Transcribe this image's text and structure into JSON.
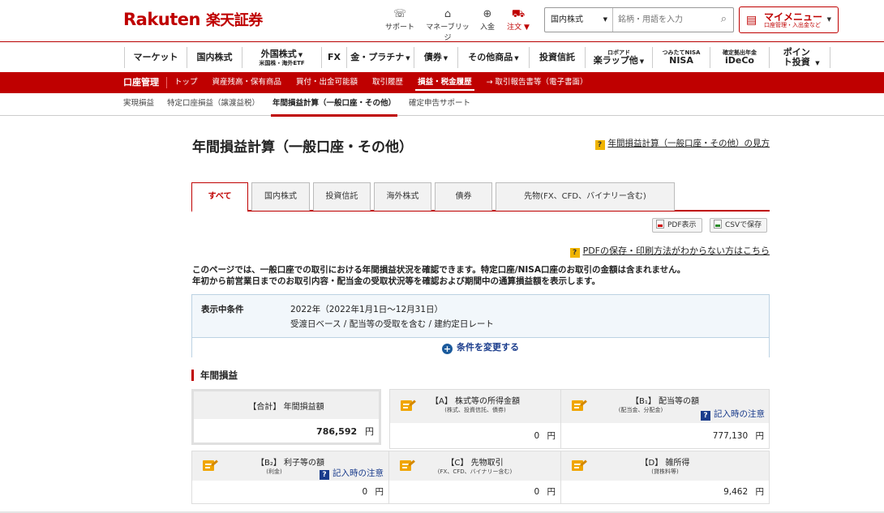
{
  "header": {
    "logo_en": "Rakuten",
    "logo_jp": "楽天証券",
    "utilities": [
      {
        "label": "サポート",
        "icon": "support-icon"
      },
      {
        "label": "マネーブリッジ",
        "icon": "bank-icon"
      },
      {
        "label": "入金",
        "icon": "deposit-icon"
      },
      {
        "label": "注文 ▼",
        "icon": "cart-icon"
      }
    ],
    "search": {
      "category": "国内株式",
      "placeholder": "銘柄・用語を入力"
    },
    "mymenu": {
      "title": "マイメニュー",
      "subtitle": "口座管理・入出金など"
    }
  },
  "global_nav": [
    {
      "label": "マーケット",
      "sub": ""
    },
    {
      "label": "国内株式",
      "sub": ""
    },
    {
      "label": "外国株式",
      "sub": "米国株・海外ETF"
    },
    {
      "label": "FX",
      "sub": ""
    },
    {
      "label": "金・プラチナ",
      "sub": ""
    },
    {
      "label": "債券",
      "sub": ""
    },
    {
      "label": "その他商品",
      "sub": ""
    },
    {
      "label": "投資信託",
      "sub": ""
    },
    {
      "label": "楽ラップ他",
      "sub": "ロボアド"
    },
    {
      "label": "NISA",
      "sub": "つみたてNISA"
    },
    {
      "label": "iDeCo",
      "sub": "確定拠出年金"
    },
    {
      "label": "ポイント投資",
      "sub": ""
    }
  ],
  "account_nav": {
    "lead": "口座管理",
    "items": [
      "トップ",
      "資産残高・保有商品",
      "買付・出金可能額",
      "取引履歴",
      "損益・税金履歴",
      "→ 取引報告書等（電子書面）"
    ]
  },
  "sub_nav": [
    "実現損益",
    "特定口座損益（譲渡益税）",
    "年間損益計算（一般口座・その他）",
    "確定申告サポート"
  ],
  "page": {
    "title": "年間損益計算（一般口座・その他）",
    "help_link": "年間損益計算（一般口座・その他）の見方",
    "tabs": [
      "すべて",
      "国内株式",
      "投資信託",
      "海外株式",
      "債券",
      "先物(FX、CFD、バイナリー含む)"
    ],
    "pdf_button": "PDF表示",
    "csv_button": "CSVで保存",
    "pdf_help": "PDFの保存・印刷方法がわからない方はこちら",
    "desc_line1": "このページでは、一般口座での取引における年間損益状況を確認できます。特定口座/NISA口座のお取引の金額は含まれません。",
    "desc_line2": "年初から前営業日までのお取引内容・配当金の受取状況等を確認および期間中の通算損益額を表示します。",
    "condition": {
      "label": "表示中条件",
      "line1": "2022年（2022年1月1日～12月31日）",
      "line2": "受渡日ベース / 配当等の受取を含む / 建約定日レート",
      "change": "条件を変更する"
    },
    "section_title": "年間損益",
    "cards": {
      "total": {
        "name": "【合計】 年間損益額",
        "value": "786,592",
        "unit": "円"
      },
      "a": {
        "name": "【A】 株式等の所得金額",
        "sub": "(株式、投資信託、債券)",
        "value": "0",
        "unit": "円"
      },
      "b1": {
        "name": "【B₁】 配当等の額",
        "sub": "(配当金、分配金)",
        "value": "777,130",
        "unit": "円",
        "note": "記入時の注意"
      },
      "b2": {
        "name": "【B₂】 利子等の額",
        "sub": "(利金)",
        "value": "0",
        "unit": "円",
        "note": "記入時の注意"
      },
      "c": {
        "name": "【C】 先物取引",
        "sub": "(FX、CFD、バイナリー含む)",
        "value": "0",
        "unit": "円"
      },
      "d": {
        "name": "【D】 雑所得",
        "sub": "(貸株料等)",
        "value": "9,462",
        "unit": "円"
      }
    }
  },
  "colors": {
    "brand_red": "#bf0000",
    "link_blue": "#1a3c8c",
    "panel_blue": "#f2f7fb"
  }
}
